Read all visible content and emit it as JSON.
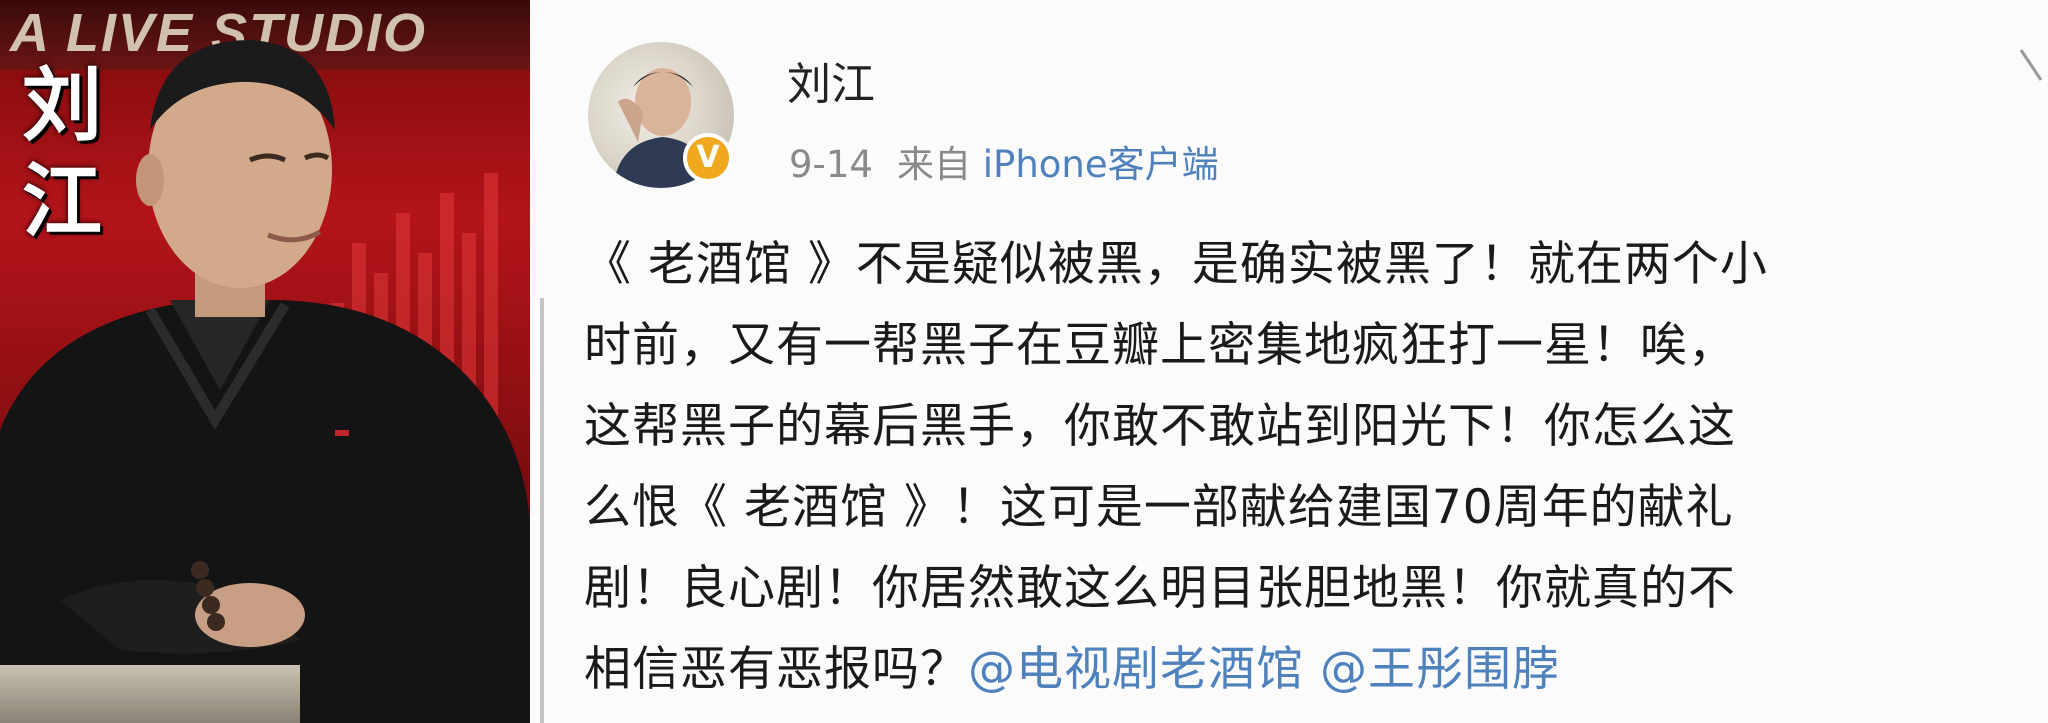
{
  "photo": {
    "studio_sign_text": "A LIVE STUDIO",
    "name_caption_chars": [
      "刘",
      "江"
    ]
  },
  "post": {
    "author": "刘江",
    "date": "9-14",
    "source_prefix": "来自",
    "client": "iPhone客户端",
    "verified_icon": "verified-v-badge",
    "body_lines": [
      "《 老酒馆 》不是疑似被黑，是确实被黑了！就在两个小",
      "时前，又有一帮黑子在豆瓣上密集地疯狂打一星！唉，",
      "这帮黑子的幕后黑手，你敢不敢站到阳光下！你怎么这",
      "么恨《 老酒馆 》！这可是一部献给建国70周年的献礼",
      "剧！良心剧！你居然敢这么明目张胆地黑！你就真的不"
    ],
    "last_line_text": "相信恶有恶报吗？",
    "mentions": [
      "@电视剧老酒馆",
      "@王彤围脖"
    ]
  },
  "colors": {
    "link_blue": "#4f81bd",
    "meta_gray": "#8a8a8a",
    "badge_orange": "#f0a81e",
    "studio_red": "#b3141a"
  }
}
